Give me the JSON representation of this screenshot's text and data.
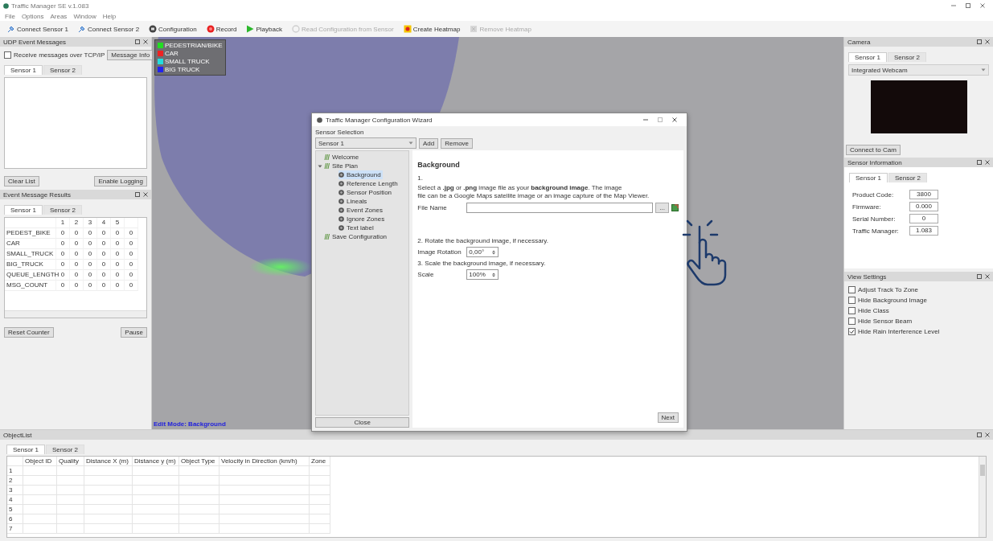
{
  "window": {
    "title": "Traffic Manager SE v.1.083"
  },
  "menu": [
    "File",
    "Options",
    "Areas",
    "Window",
    "Help"
  ],
  "toolbar": [
    {
      "label": "Connect Sensor 1",
      "kind": "plug",
      "disabled": false
    },
    {
      "label": "Connect Sensor 2",
      "kind": "plug",
      "disabled": false
    },
    {
      "label": "Configuration",
      "kind": "gear",
      "disabled": false
    },
    {
      "label": "Record",
      "kind": "record",
      "disabled": false
    },
    {
      "label": "Playback",
      "kind": "play",
      "disabled": false
    },
    {
      "label": "Read Configuration from Sensor",
      "kind": "download",
      "disabled": true
    },
    {
      "label": "Create Heatmap",
      "kind": "heatmap",
      "disabled": false
    },
    {
      "label": "Remove Heatmap",
      "kind": "remove",
      "disabled": true
    }
  ],
  "udp_panel": {
    "title": "UDP Event Messages",
    "receive": {
      "label": "Receive messages over TCP/IP",
      "checked": false
    },
    "info_button": "Message Info",
    "tabs": [
      {
        "label": "Sensor 1",
        "selected": true
      },
      {
        "label": "Sensor 2",
        "selected": false
      }
    ],
    "buttons": [
      "Clear List",
      "Enable Logging"
    ]
  },
  "results_panel": {
    "title": "Event Message Results",
    "tabs": [
      {
        "label": "Sensor 1",
        "selected": true
      },
      {
        "label": "Sensor 2",
        "selected": false
      }
    ],
    "columns": [
      "1",
      "2",
      "3",
      "4",
      "5"
    ],
    "rows": [
      {
        "label": "PEDEST_BIKE",
        "values": [
          "0",
          "0",
          "0",
          "0",
          "0",
          "0"
        ]
      },
      {
        "label": "CAR",
        "values": [
          "0",
          "0",
          "0",
          "0",
          "0",
          "0"
        ]
      },
      {
        "label": "SMALL_TRUCK",
        "values": [
          "0",
          "0",
          "0",
          "0",
          "0",
          "0"
        ]
      },
      {
        "label": "BIG_TRUCK",
        "values": [
          "0",
          "0",
          "0",
          "0",
          "0",
          "0"
        ]
      },
      {
        "label": "QUEUE_LENGTH",
        "values": [
          "0",
          "0",
          "0",
          "0",
          "0",
          "0"
        ]
      },
      {
        "label": "MSG_COUNT",
        "values": [
          "0",
          "0",
          "0",
          "0",
          "0",
          "0"
        ]
      }
    ],
    "buttons": [
      "Reset Counter",
      "Pause"
    ]
  },
  "map": {
    "legend": [
      {
        "label": "PEDESTRIAN/BIKE",
        "color": "#22dd22"
      },
      {
        "label": "CAR",
        "color": "#ee2222"
      },
      {
        "label": "SMALL TRUCK",
        "color": "#22dddd"
      },
      {
        "label": "BIG TRUCK",
        "color": "#2222ee"
      }
    ],
    "mode_text": "Edit Mode: Background"
  },
  "wizard": {
    "title": "Traffic Manager Configuration Wizard",
    "selection_label": "Sensor Selection",
    "sensor": "Sensor 1",
    "buttons": [
      "Add",
      "Remove"
    ],
    "tree": [
      {
        "label": "Welcome",
        "kind": "group",
        "selected": false
      },
      {
        "label": "Site Plan",
        "kind": "group",
        "selected": false,
        "expanded": true,
        "children": [
          {
            "label": "Background",
            "kind": "page",
            "selected": true
          },
          {
            "label": "Reference Length",
            "kind": "page",
            "selected": false
          },
          {
            "label": "Sensor Position",
            "kind": "page",
            "selected": false
          },
          {
            "label": "Lineals",
            "kind": "page",
            "selected": false
          },
          {
            "label": "Event Zones",
            "kind": "page",
            "selected": false
          },
          {
            "label": "Ignore Zones",
            "kind": "page",
            "selected": false
          },
          {
            "label": "Text label",
            "kind": "page",
            "selected": false
          }
        ]
      },
      {
        "label": "Save Configuration",
        "kind": "group",
        "selected": false
      }
    ],
    "close_button": "Close",
    "page": {
      "heading": "Background",
      "step1": "1.",
      "step1_text": "Select a **.jpg** or **.png** image file as your **background image**. The image\nfile can be a Google Maps satellite image or an image capture of the Map Viewer.",
      "file_label": "File Name",
      "browse_button": "...",
      "step2": "2. Rotate the background image, if necessary.",
      "rotation_label": "Image Rotation",
      "rotation": "0,00°",
      "step3": "3. Scale the background image, if necessary.",
      "scale_label": "Scale",
      "scale": "100%"
    },
    "next_button": "Next"
  },
  "camera_panel": {
    "title": "Camera",
    "tabs": [
      {
        "label": "Sensor 1",
        "selected": true
      },
      {
        "label": "Sensor 2",
        "selected": false
      }
    ],
    "source": "Integrated Webcam",
    "button": "Connect to Cam"
  },
  "sensor_info": {
    "title": "Sensor Information",
    "tabs": [
      {
        "label": "Sensor 1",
        "selected": true
      },
      {
        "label": "Sensor 2",
        "selected": false
      }
    ],
    "fields": [
      {
        "label": "Product Code:",
        "value": "3800"
      },
      {
        "label": "Firmware:",
        "value": "0.000"
      },
      {
        "label": "Serial Number:",
        "value": "0"
      },
      {
        "label": "Traffic Manager:",
        "value": "1.083"
      }
    ]
  },
  "view_settings": {
    "title": "View Settings",
    "options": [
      {
        "label": "Adjust Track To Zone",
        "checked": false
      },
      {
        "label": "Hide Background Image",
        "checked": false
      },
      {
        "label": "Hide Class",
        "checked": false
      },
      {
        "label": "Hide Sensor Beam",
        "checked": false
      },
      {
        "label": "Hide Rain Interference Level",
        "checked": true
      }
    ]
  },
  "object_list": {
    "title": "ObjectList",
    "tabs": [
      {
        "label": "Sensor 1",
        "selected": true
      },
      {
        "label": "Sensor 2",
        "selected": false
      }
    ],
    "columns": [
      "Object ID",
      "Quality",
      "Distance X (m)",
      "Distance y (m)",
      "Object Type",
      "Velocity in Direction (km/h)",
      "Zone"
    ],
    "rows": [
      "1",
      "2",
      "3",
      "4",
      "5",
      "6",
      "7"
    ]
  }
}
